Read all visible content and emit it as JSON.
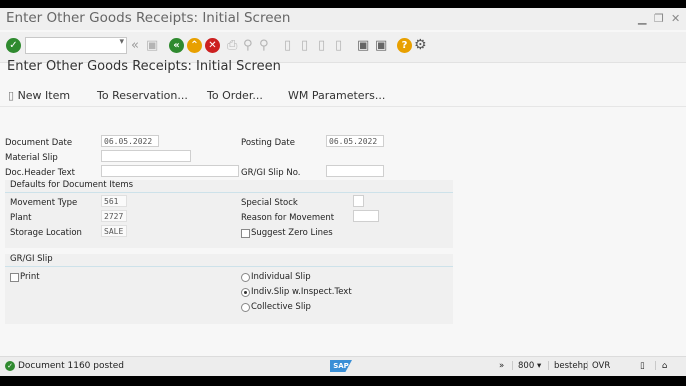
{
  "window": {
    "title": "Enter Other Goods Receipts: Initial Screen"
  },
  "toolbar": {
    "command_field_value": "",
    "icons": [
      "enter-icon",
      "back-icon",
      "exit-icon",
      "cancel-icon",
      "print-icon",
      "find-icon",
      "first-page-icon",
      "layout-icon",
      "help-icon",
      "settings-icon"
    ]
  },
  "screen_title": "Enter Other Goods Receipts: Initial Screen",
  "app_toolbar": {
    "new_item": "New Item",
    "to_reservation": "To Reservation...",
    "to_order": "To Order...",
    "wm_parameters": "WM Parameters..."
  },
  "header": {
    "document_date_label": "Document Date",
    "document_date_value": "06.05.2022",
    "posting_date_label": "Posting Date",
    "posting_date_value": "06.05.2022",
    "material_slip_label": "Material Slip",
    "material_slip_value": "",
    "doc_header_text_label": "Doc.Header Text",
    "doc_header_text_value": "",
    "gr_gi_slip_no_label": "GR/GI Slip No.",
    "gr_gi_slip_no_value": ""
  },
  "defaults": {
    "title": "Defaults for Document Items",
    "movement_type_label": "Movement Type",
    "movement_type_value": "561",
    "plant_label": "Plant",
    "plant_value": "2727",
    "storage_location_label": "Storage Location",
    "storage_location_value": "SALE",
    "special_stock_label": "Special Stock",
    "special_stock_value": "",
    "reason_label": "Reason for Movement",
    "reason_value": "",
    "suggest_zero_lines_label": "Suggest Zero Lines",
    "suggest_zero_lines_checked": false
  },
  "slip": {
    "title": "GR/GI Slip",
    "print_label": "Print",
    "print_checked": false,
    "options": [
      {
        "label": "Individual Slip",
        "selected": false
      },
      {
        "label": "Indiv.Slip w.Inspect.Text",
        "selected": true
      },
      {
        "label": "Collective Slip",
        "selected": false
      }
    ]
  },
  "status_bar": {
    "message": "Document 1160 posted",
    "client": "800",
    "server": "bestehp",
    "mode": "OVR",
    "brand_color": "#3a8fd6",
    "ok_color": "#2f8a2f"
  }
}
